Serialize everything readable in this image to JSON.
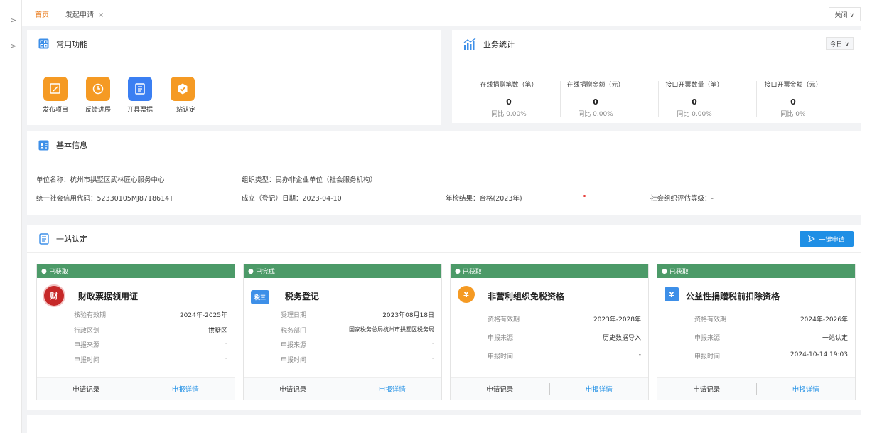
{
  "tabs": {
    "home": "首页",
    "apply": "发起申请",
    "close_x": "×",
    "close_menu": "关闭",
    "close_caret": "∨"
  },
  "common_functions": {
    "title": "常用功能",
    "items": [
      {
        "label": "发布项目",
        "color": "#f59a23"
      },
      {
        "label": "反馈进展",
        "color": "#f59a23"
      },
      {
        "label": "开具票据",
        "color": "#3b7ff2"
      },
      {
        "label": "一站认定",
        "color": "#f59a23"
      }
    ]
  },
  "business_stats": {
    "title": "业务统计",
    "period": "今日",
    "period_caret": "∨",
    "items": [
      {
        "label": "在线捐赠笔数（笔）",
        "value": "0",
        "yoy_label": "同比",
        "yoy": "0.00%"
      },
      {
        "label": "在线捐赠金额（元）",
        "value": "0",
        "yoy_label": "同比",
        "yoy": "0.00%"
      },
      {
        "label": "接口开票数量（笔）",
        "value": "0",
        "yoy_label": "同比",
        "yoy": "0.00%"
      },
      {
        "label": "接口开票金额（元）",
        "value": "0",
        "yoy_label": "同比",
        "yoy": "0%"
      }
    ]
  },
  "basic_info": {
    "title": "基本信息",
    "org_name": "单位名称：杭州市拱墅区武林匠心服务中心",
    "org_type": "组织类型：民办非企业单位（社会服务机构）",
    "credit_code": "统一社会信用代码：52330105MJ8718614T",
    "reg_date": "成立（登记）日期：2023-04-10",
    "annual_check": "年检结果：合格(2023年)",
    "eval_level": "社会组织评估等级：-"
  },
  "one_stop": {
    "title": "一站认定",
    "apply_button": "一键申请",
    "record_label": "申请记录",
    "detail_label": "申报详情",
    "certs": [
      {
        "status": "已获取",
        "title": "财政票据领用证",
        "logo_text": "财",
        "logo_color": "#c62828",
        "rows": [
          {
            "k": "核验有效期",
            "v": "2024年-2025年"
          },
          {
            "k": "行政区划",
            "v": "拱墅区"
          },
          {
            "k": "申报来源",
            "v": "-"
          },
          {
            "k": "申报时间",
            "v": "-"
          }
        ]
      },
      {
        "status": "已完成",
        "title": "税务登记",
        "logo_text": "税三",
        "logo_color": "#3d8fe8",
        "rows": [
          {
            "k": "受理日期",
            "v": "2023年08月18日"
          },
          {
            "k": "税务部门",
            "v": "国家税务总局杭州市拱墅区税务局"
          },
          {
            "k": "申报来源",
            "v": "-"
          },
          {
            "k": "申报时间",
            "v": "-"
          }
        ]
      },
      {
        "status": "已获取",
        "title": "非营利组织免税资格",
        "logo_text": "¥",
        "logo_color": "#f59a23",
        "rows": [
          {
            "k": "资格有效期",
            "v": "2023年-2028年"
          },
          {
            "k": "申报来源",
            "v": "历史数据导入"
          },
          {
            "k": "申报时间",
            "v": "-"
          }
        ]
      },
      {
        "status": "已获取",
        "title": "公益性捐赠税前扣除资格",
        "logo_text": "¥",
        "logo_color": "#3d8fe8",
        "rows": [
          {
            "k": "资格有效期",
            "v": "2024年-2026年"
          },
          {
            "k": "申报来源",
            "v": "一站认定"
          },
          {
            "k": "申报时间",
            "v": "2024-10-14 19:03"
          }
        ]
      }
    ]
  }
}
